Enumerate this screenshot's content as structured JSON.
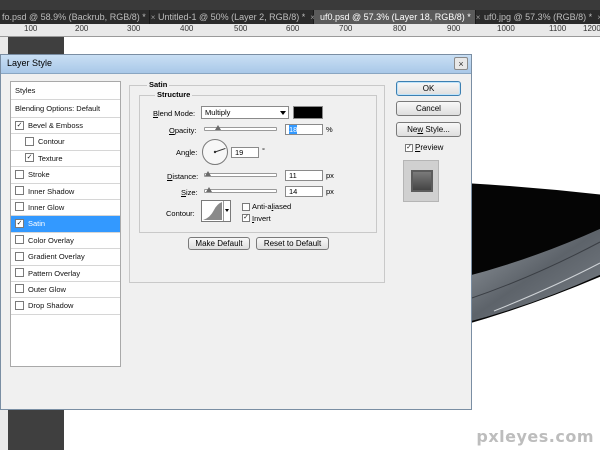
{
  "tabs": [
    {
      "label": "fo.psd @ 58.9% (Backrub, RGB/8) *",
      "close": "×",
      "active": false
    },
    {
      "label": "Untitled-1 @ 50% (Layer 2, RGB/8) *",
      "close": "×",
      "active": false
    },
    {
      "label": "uf0.psd @ 57.3% (Layer 18, RGB/8) *",
      "close": "×",
      "active": true
    },
    {
      "label": "uf0.jpg @ 57.3% (RGB/8) *",
      "close": "×",
      "active": false
    }
  ],
  "ruler": {
    "numbers": [
      "100",
      "200",
      "300",
      "400",
      "500",
      "600",
      "700",
      "800",
      "900",
      "1000",
      "1100",
      "1200"
    ]
  },
  "dialog": {
    "title": "Layer Style",
    "close_glyph": "×",
    "styles_list": [
      {
        "label": "Styles",
        "checked": null,
        "selected": false,
        "indent": false,
        "header": true
      },
      {
        "label": "Blending Options: Default",
        "checked": null,
        "selected": false,
        "indent": false,
        "header": true
      },
      {
        "label": "Bevel & Emboss",
        "checked": true,
        "selected": false,
        "indent": false
      },
      {
        "label": "Contour",
        "checked": false,
        "selected": false,
        "indent": true
      },
      {
        "label": "Texture",
        "checked": true,
        "selected": false,
        "indent": true
      },
      {
        "label": "Stroke",
        "checked": false,
        "selected": false,
        "indent": false
      },
      {
        "label": "Inner Shadow",
        "checked": false,
        "selected": false,
        "indent": false
      },
      {
        "label": "Inner Glow",
        "checked": false,
        "selected": false,
        "indent": false
      },
      {
        "label": "Satin",
        "checked": true,
        "selected": true,
        "indent": false
      },
      {
        "label": "Color Overlay",
        "checked": false,
        "selected": false,
        "indent": false
      },
      {
        "label": "Gradient Overlay",
        "checked": false,
        "selected": false,
        "indent": false
      },
      {
        "label": "Pattern Overlay",
        "checked": false,
        "selected": false,
        "indent": false
      },
      {
        "label": "Outer Glow",
        "checked": false,
        "selected": false,
        "indent": false
      },
      {
        "label": "Drop Shadow",
        "checked": false,
        "selected": false,
        "indent": false
      }
    ],
    "satin": {
      "group_title": "Satin",
      "structure_title": "Structure",
      "blend_mode_label_pre": "B",
      "blend_mode_label": "lend Mode:",
      "blend_mode_value": "Multiply",
      "blend_color": "#000000",
      "opacity_label_pre": "O",
      "opacity_label": "pacity:",
      "opacity_value": "18",
      "opacity_unit": "%",
      "opacity_fraction": 0.18,
      "angle_label_pre": "An",
      "angle_label_accel": "g",
      "angle_label": "le:",
      "angle_value": "19",
      "angle_unit": "°",
      "distance_label_pre": "D",
      "distance_label": "istance:",
      "distance_value": "11",
      "distance_unit": "px",
      "distance_fraction": 0.045,
      "size_label_pre": "S",
      "size_label": "ize:",
      "size_value": "14",
      "size_unit": "px",
      "size_fraction": 0.06,
      "contour_label": "Contour:",
      "antialiased_label_pre": "Anti-a",
      "antialiased_label_accel": "l",
      "antialiased_label": "iased",
      "antialiased_checked": false,
      "invert_label_pre": "",
      "invert_label_accel": "I",
      "invert_label": "nvert",
      "invert_checked": true,
      "make_default_label": "Make Default",
      "reset_default_label": "Reset to Default"
    },
    "buttons": {
      "ok": "OK",
      "cancel": "Cancel",
      "new_style_pre": "Ne",
      "new_style_accel": "w",
      "new_style_rest": " Style...",
      "preview_pre": "",
      "preview_accel": "P",
      "preview_rest": "review",
      "preview_checked": true
    }
  },
  "canvas": {
    "watermark": "pxleyes.com"
  },
  "check_glyph": "✓"
}
